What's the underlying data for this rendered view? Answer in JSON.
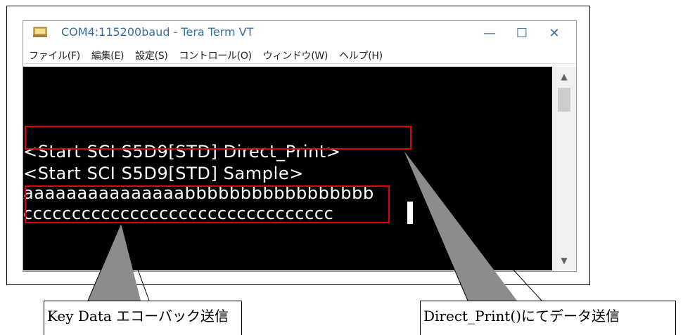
{
  "window": {
    "title": "COM4:115200baud - Tera Term VT",
    "minimize_glyph": "—",
    "maximize_glyph": "☐",
    "close_glyph": "✕"
  },
  "menu": {
    "items": [
      {
        "label": "ファイル(F)"
      },
      {
        "label": "編集(E)"
      },
      {
        "label": "設定(S)"
      },
      {
        "label": "コントロール(O)"
      },
      {
        "label": "ウィンドウ(W)"
      },
      {
        "label": "ヘルプ(H)"
      }
    ]
  },
  "terminal": {
    "lines": [
      "<Start SCI S5D9[STD] Direct_Print>",
      "<Start SCI S5D9[STD] Sample>",
      "aaaaaaaaaaaaaaabbbbbbbbbbbbbbbbb",
      "cccccccccccccccccccccccccccccccc"
    ]
  },
  "scrollbar": {
    "up_glyph": "▲",
    "down_glyph": "▼"
  },
  "callouts": {
    "left_label": "Key Data エコーバック送信",
    "right_label": "Direct_Print()にてデータ送信"
  },
  "colors": {
    "highlight": "#e00000",
    "terminal_bg": "#000000",
    "terminal_fg": "#ffffff"
  }
}
